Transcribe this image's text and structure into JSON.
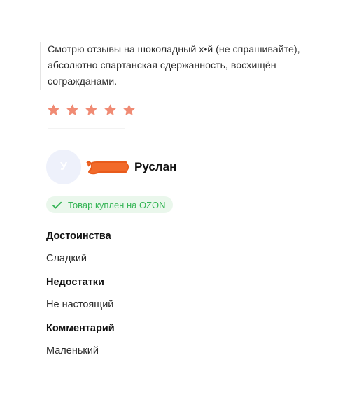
{
  "post": {
    "text": "Смотрю отзывы на шоколадный х•й (не спрашивайте), абсолютно спартанская сдержанность, восхищён согражданами."
  },
  "rating": {
    "value": 5,
    "max": 5,
    "star_color": "#f08b74"
  },
  "review": {
    "avatar_letter": "У",
    "user_name": "Руслан",
    "purchase_badge": "Товар куплен на OZON",
    "badge_color": "#36b556",
    "sections": [
      {
        "title": "Достоинства",
        "value": "Сладкий"
      },
      {
        "title": "Недостатки",
        "value": "Не настоящий"
      },
      {
        "title": "Комментарий",
        "value": "Маленький"
      }
    ]
  }
}
